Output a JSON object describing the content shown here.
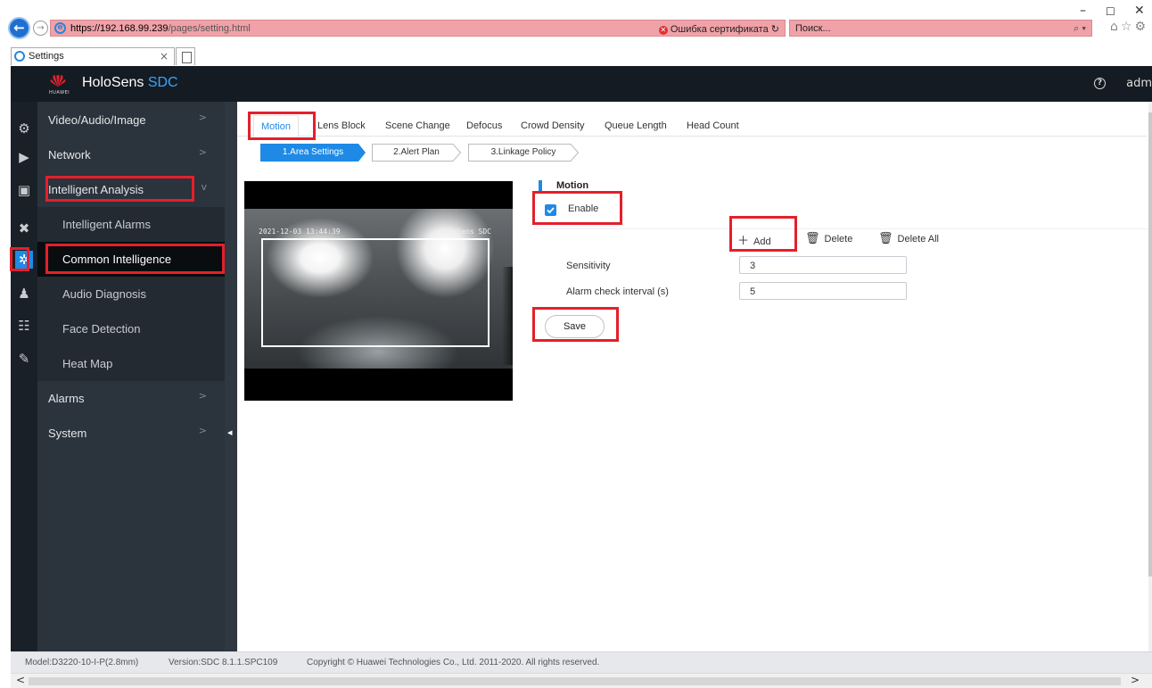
{
  "browser": {
    "url_host": "https://192.168.99.239",
    "url_path": "/pages/setting.html",
    "cert_error": "Ошибка сертификата",
    "search_placeholder": "Поиск...",
    "tab_title": "Settings"
  },
  "header": {
    "logo_text": "HUAWEI",
    "brand": "HoloSens",
    "brand_suffix": "SDC",
    "user": "adm"
  },
  "sidebar": {
    "items": [
      {
        "label": "Video/Audio/Image"
      },
      {
        "label": "Network"
      },
      {
        "label": "Intelligent Analysis"
      },
      {
        "label": "Intelligent Alarms"
      },
      {
        "label": "Common Intelligence"
      },
      {
        "label": "Audio Diagnosis"
      },
      {
        "label": "Face Detection"
      },
      {
        "label": "Heat Map"
      },
      {
        "label": "Alarms"
      },
      {
        "label": "System"
      }
    ]
  },
  "tabs": [
    "Motion",
    "Lens Block",
    "Scene Change",
    "Defocus",
    "Crowd Density",
    "Queue Length",
    "Head Count"
  ],
  "steps": [
    "1.Area Settings",
    "2.Alert Plan",
    "3.Linkage Policy"
  ],
  "video": {
    "timestamp": "2021-12-03 13:44:39",
    "watermark": "HoloSens SDC"
  },
  "motion": {
    "title": "Motion",
    "enable_label": "Enable",
    "enabled": true,
    "add": "Add",
    "delete": "Delete",
    "delete_all": "Delete All",
    "sensitivity_label": "Sensitivity",
    "sensitivity_value": "3",
    "interval_label": "Alarm check interval (s)",
    "interval_value": "5",
    "save": "Save"
  },
  "footer": {
    "model": "Model:D3220-10-I-P(2.8mm)",
    "version": "Version:SDC 8.1.1.SPC109",
    "copyright": "Copyright © Huawei Technologies Co., Ltd. 2011-2020. All rights reserved."
  },
  "colors": {
    "accent": "#1e8ae6",
    "highlight": "#e3202b",
    "header_bg": "#151b22",
    "sidebar_bg": "#2b333c"
  }
}
